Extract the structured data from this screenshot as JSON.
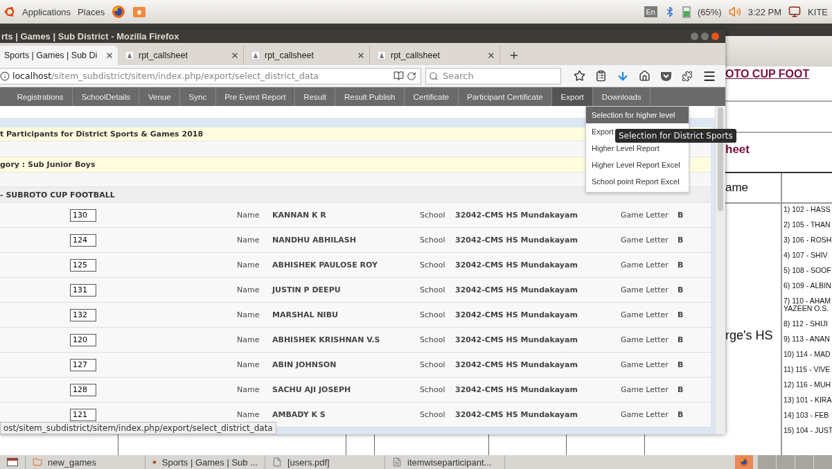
{
  "top_panel": {
    "menus": [
      "Applications",
      "Places"
    ],
    "keyboard_layout": "En",
    "battery": "(65%)",
    "clock": "3:22 PM",
    "user": "KITE"
  },
  "document": {
    "title": "OTO CUP FOOT",
    "subtitle": "heet",
    "column_header": "ame",
    "school": "rge's HS",
    "players": [
      "1) 102 - HASS",
      "2) 105 - THAN",
      "3) 106 - ROSH",
      "4) 107 - SHIV",
      "5) 108 - SOOF",
      "6) 109 - ALBIN",
      "7) 110 - AHAM\nYAZEEN O.S.",
      "8) 112 - SHIJI",
      "9) 113 - ANAN",
      "10) 114 - MAD",
      "11) 115 - VIVE",
      "12) 116 - MUH",
      "13) 101 - KIRA",
      "14) 103 - FEB",
      "15) 104 - JUST"
    ]
  },
  "browser": {
    "title": "rts | Games | Sub District - Mozilla Firefox",
    "tabs": [
      {
        "label": "Sports | Games | Sub Di",
        "selected": true
      },
      {
        "label": "rpt_callsheet",
        "selected": false
      },
      {
        "label": "rpt_callsheet",
        "selected": false
      },
      {
        "label": "rpt_callsheet",
        "selected": false
      }
    ],
    "url_host": "localhost",
    "url_path": "/sitem_subdistrict/sitem/index.php/export/select_district_data",
    "search": {
      "placeholder": "Search"
    },
    "status_url": "ost/sitem_subdistrict/sitem/index.php/export/select_district_data"
  },
  "page": {
    "menu": [
      {
        "label": "Registrations",
        "selected": false
      },
      {
        "label": "SchoolDetails",
        "selected": false
      },
      {
        "label": "Venue",
        "selected": false
      },
      {
        "label": "Sync",
        "selected": false
      },
      {
        "label": "Pre Event Report",
        "selected": false
      },
      {
        "label": "Result",
        "selected": false
      },
      {
        "label": "Result Publish",
        "selected": false
      },
      {
        "label": "Certificate",
        "selected": false
      },
      {
        "label": "Participant Certificate",
        "selected": false
      },
      {
        "label": "Export",
        "selected": true
      },
      {
        "label": "Downloads",
        "selected": false
      }
    ],
    "export_menu": [
      {
        "label": "Selection for higher level",
        "selected": true
      },
      {
        "label": "Export",
        "selected": false
      },
      {
        "label": "Higher Level Report",
        "selected": false
      },
      {
        "label": "Higher Level Report Excel",
        "selected": false
      },
      {
        "label": "School point Report Excel",
        "selected": false
      }
    ],
    "tooltip": "Selection for District Sports",
    "heading": "t Participants for District Sports & Games 2018",
    "category": "gory : Sub Junior Boys",
    "event": "- SUBROTO CUP FOOTBALL",
    "rows": [
      {
        "chest_no": "130",
        "name_label": "Name",
        "name": "KANNAN K R",
        "school_label": "School",
        "school": "32042-CMS HS Mundakayam",
        "letter_label": "Game Letter",
        "letter": "B"
      },
      {
        "chest_no": "124",
        "name_label": "Name",
        "name": "NANDHU ABHILASH",
        "school_label": "School",
        "school": "32042-CMS HS Mundakayam",
        "letter_label": "Game Letter",
        "letter": "B"
      },
      {
        "chest_no": "125",
        "name_label": "Name",
        "name": "ABHISHEK PAULOSE ROY",
        "school_label": "School",
        "school": "32042-CMS HS Mundakayam",
        "letter_label": "Game Letter",
        "letter": "B"
      },
      {
        "chest_no": "131",
        "name_label": "Name",
        "name": "JUSTIN P DEEPU",
        "school_label": "School",
        "school": "32042-CMS HS Mundakayam",
        "letter_label": "Game Letter",
        "letter": "B"
      },
      {
        "chest_no": "132",
        "name_label": "Name",
        "name": "MARSHAL NIBU",
        "school_label": "School",
        "school": "32042-CMS HS Mundakayam",
        "letter_label": "Game Letter",
        "letter": "B"
      },
      {
        "chest_no": "120",
        "name_label": "Name",
        "name": "ABHISHEK KRISHNAN V.S",
        "school_label": "School",
        "school": "32042-CMS HS Mundakayam",
        "letter_label": "Game Letter",
        "letter": "B"
      },
      {
        "chest_no": "127",
        "name_label": "Name",
        "name": "ABIN JOHNSON",
        "school_label": "School",
        "school": "32042-CMS HS Mundakayam",
        "letter_label": "Game Letter",
        "letter": "B"
      },
      {
        "chest_no": "128",
        "name_label": "Name",
        "name": "SACHU AJI JOSEPH",
        "school_label": "School",
        "school": "32042-CMS HS Mundakayam",
        "letter_label": "Game Letter",
        "letter": "B"
      },
      {
        "chest_no": "121",
        "name_label": "Name",
        "name": "AMBADY K S",
        "school_label": "School",
        "school": "32042-CMS HS Mundakayam",
        "letter_label": "Game Letter",
        "letter": "B"
      }
    ]
  },
  "taskbar": {
    "items": [
      {
        "label": "new_games",
        "kind": "folder"
      },
      {
        "label": "Sports | Games | Sub ...",
        "kind": "browser"
      },
      {
        "label": "[users.pdf]",
        "kind": "pdf"
      },
      {
        "label": "itemwiseparticipant...",
        "kind": "document"
      }
    ]
  }
}
